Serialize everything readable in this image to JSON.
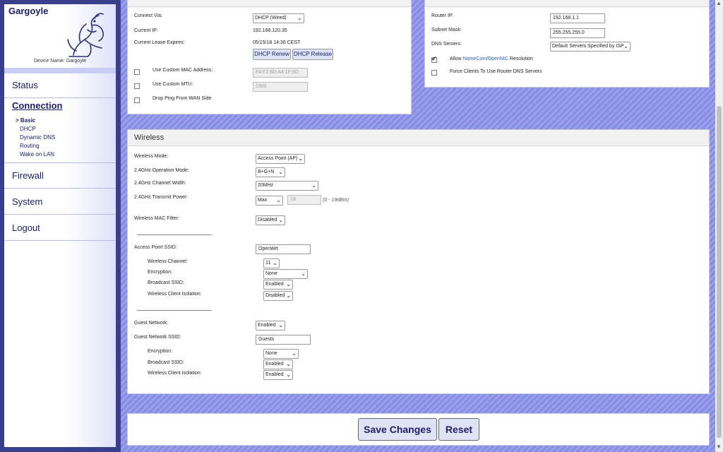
{
  "sidebar": {
    "brand": "Gargoyle",
    "device_name": "Device Name: Gargoyle",
    "items": {
      "status": "Status",
      "connection": "Connection",
      "firewall": "Firewall",
      "system": "System",
      "logout": "Logout"
    },
    "subitems": {
      "basic": "> Basic",
      "dhcp": "DHCP",
      "ddns": "Dynamic DNS",
      "routing": "Routing",
      "wol": "Wake on LAN"
    }
  },
  "wan": {
    "connect_via_label": "Connect Via:",
    "connect_via_value": "DHCP (Wired)",
    "current_ip_label": "Current IP:",
    "current_ip_value": "192.168.120.35",
    "lease_label": "Current Lease Expires:",
    "lease_value": "05/15/18 14:36 CEST",
    "dhcp_renew": "DHCP Renew",
    "dhcp_release": "DHCP Release",
    "custom_mac_label": "Use Custom MAC Address:",
    "custom_mac_value": "F4:F2:6D:A4:1F:5D",
    "custom_mtu_label": "Use Custom MTU:",
    "custom_mtu_value": "1500",
    "drop_ping_label": "Drop Ping From WAN Side"
  },
  "lan": {
    "router_ip_label": "Router IP:",
    "router_ip_value": "192.168.1.1",
    "subnet_label": "Subnet Mask:",
    "subnet_value": "255.255.255.0",
    "dns_label": "DNS Servers:",
    "dns_value": "Default Servers Specified by ISP",
    "allow_prefix": "Allow",
    "namecoin": "NameCoin",
    "slash": "/",
    "opennic": "OpenNIC",
    "resolution": "Resolution",
    "force_clients_label": "Force Clients To Use Router DNS Servers"
  },
  "wireless": {
    "title": "Wireless",
    "mode_label": "Wireless Mode:",
    "mode_value": "Access Point (AP)",
    "op_mode_label": "2.4GHz Operation Mode:",
    "op_mode_value": "B+G+N",
    "channel_width_label": "2.4GHz Channel Width:",
    "channel_width_value": "20MHz",
    "tx_power_label": "2.4GHz Transmit Power:",
    "tx_power_value": "Max",
    "tx_power_dbm": "19",
    "tx_power_range": "(0 - 19dBm)",
    "mac_filter_label": "Wireless MAC Filter:",
    "mac_filter_value": "Disabled",
    "ap_ssid_label": "Access Point SSID:",
    "ap_ssid_value": "OpenWrt",
    "channel_label": "Wireless Channel:",
    "channel_value": "11",
    "encryption_label": "Encryption:",
    "encryption_value": "None",
    "broadcast_label": "Broadcast SSID:",
    "broadcast_value": "Enabled",
    "isolation_label": "Wireless Client Isolation:",
    "isolation_value": "Disabled",
    "guest_label": "Guest Network:",
    "guest_value": "Enabled",
    "guest_ssid_label": "Guest Network SSID:",
    "guest_ssid_value": "Guests",
    "guest_encryption_label": "Encryption:",
    "guest_encryption_value": "None",
    "guest_broadcast_label": "Broadcast SSID:",
    "guest_broadcast_value": "Enabled",
    "guest_isolation_label": "Wireless Client Isolation:",
    "guest_isolation_value": "Enabled"
  },
  "actions": {
    "save": "Save Changes",
    "reset": "Reset"
  }
}
